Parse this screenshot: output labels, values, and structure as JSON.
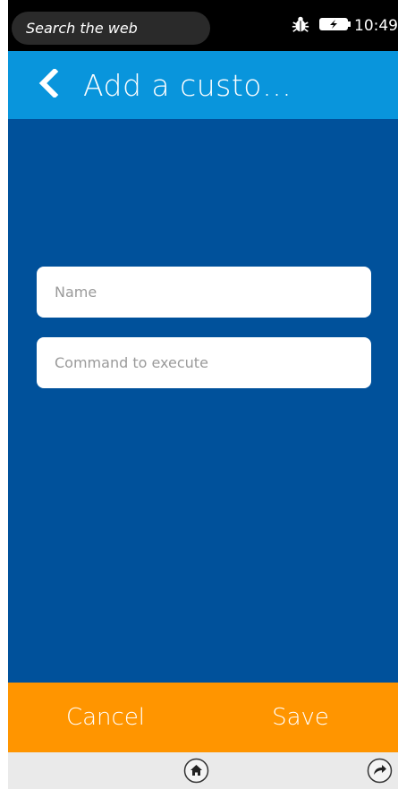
{
  "status_bar": {
    "search_placeholder": "Search the web",
    "time": "10:49",
    "icons": [
      "bug-icon",
      "battery-charging-icon"
    ]
  },
  "header": {
    "title": "Add a custo…",
    "back_icon": "chevron-left-icon"
  },
  "form": {
    "name_placeholder": "Name",
    "command_placeholder": "Command to execute"
  },
  "actions": {
    "cancel_label": "Cancel",
    "save_label": "Save"
  },
  "home_bar": {
    "icons": [
      "home-icon",
      "forward-icon"
    ]
  },
  "colors": {
    "status_bar": "#000000",
    "header": "#0995dc",
    "main": "#00519b",
    "action_bar": "#ff9500",
    "home_bar": "#eaeaea"
  }
}
